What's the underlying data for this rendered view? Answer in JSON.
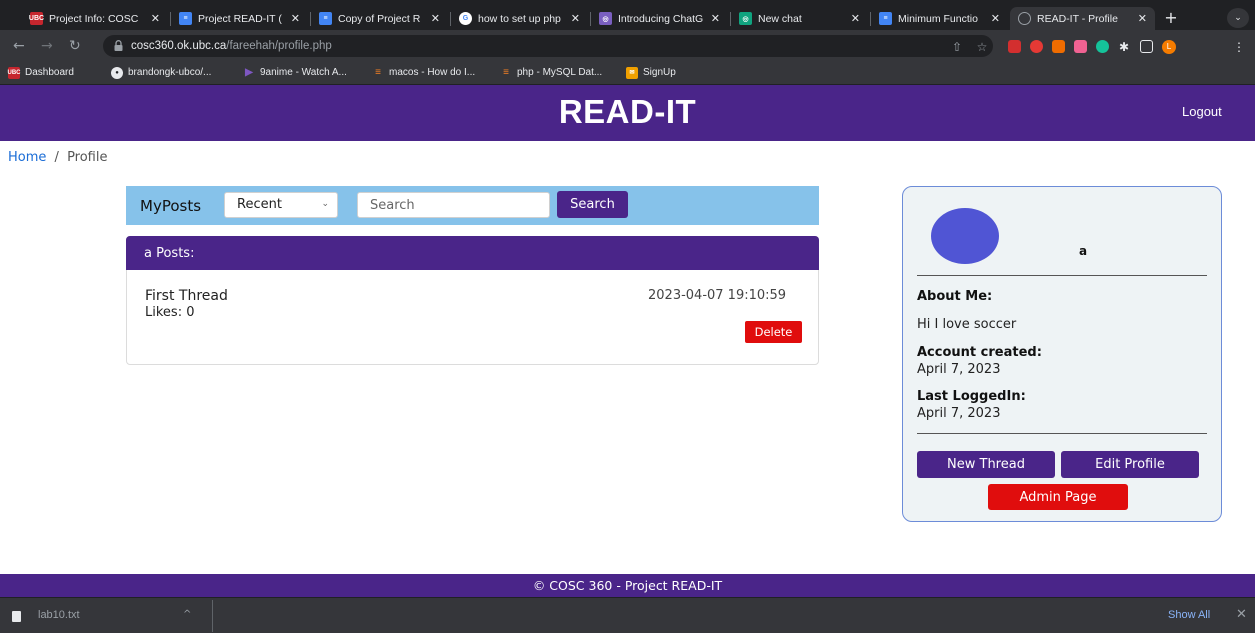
{
  "browser": {
    "tabs": [
      {
        "title": "Project Info: COSC",
        "favicon": "ubc-icon",
        "color": "#c6262e"
      },
      {
        "title": "Project READ-IT (",
        "favicon": "docs-icon",
        "color": "#4285f4"
      },
      {
        "title": "Copy of Project R",
        "favicon": "docs-icon",
        "color": "#4285f4"
      },
      {
        "title": "how to set up php",
        "favicon": "google-icon",
        "color": "#ffffff"
      },
      {
        "title": "Introducing ChatG",
        "favicon": "openai-icon",
        "color": "#7a5fc0"
      },
      {
        "title": "New chat",
        "favicon": "chatgpt-icon",
        "color": "#10a37f"
      },
      {
        "title": "Minimum Functio",
        "favicon": "docs-icon",
        "color": "#4285f4"
      },
      {
        "title": "READ-IT - Profile",
        "favicon": "globe-icon",
        "color": "#9aa0a6"
      }
    ],
    "url_host": "cosc360.ok.ubc.ca",
    "url_path": "/fareehah/profile.php",
    "bookmarks": [
      {
        "label": "Dashboard",
        "icon": "ubc-icon",
        "color": "#c6262e"
      },
      {
        "label": "brandongk-ubco/...",
        "icon": "github-icon",
        "color": "#e8eaed"
      },
      {
        "label": "9anime - Watch A...",
        "icon": "play-icon",
        "color": "#7e57c2"
      },
      {
        "label": "macos - How do I...",
        "icon": "stack-icon",
        "color": "#f48024"
      },
      {
        "label": "php - MySQL Dat...",
        "icon": "stack-icon",
        "color": "#f48024"
      },
      {
        "label": "SignUp",
        "icon": "app-icon",
        "color": "#f0a000"
      }
    ],
    "profile_initial": "L"
  },
  "site": {
    "title": "READ-IT",
    "logout": "Logout",
    "colors": {
      "primary": "#4a2589",
      "accent": "#86c2ea",
      "danger": "#e00d0d"
    }
  },
  "breadcrumb": {
    "home": "Home",
    "sep": "/",
    "current": "Profile"
  },
  "posts": {
    "heading": "MyPosts",
    "sort_value": "Recent",
    "search_placeholder": "Search",
    "search_button": "Search",
    "list_header": "a Posts:",
    "items": [
      {
        "title": "First Thread",
        "likes": "Likes: 0",
        "date": "2023-04-07 19:10:59",
        "delete": "Delete"
      }
    ]
  },
  "profile": {
    "username": "a",
    "about_label": "About Me:",
    "about_value": "Hi I love soccer",
    "created_label": "Account created:",
    "created_value": "April 7, 2023",
    "lastlogin_label": "Last LoggedIn:",
    "lastlogin_value": "April 7, 2023",
    "new_thread": "New Thread",
    "edit_profile": "Edit Profile",
    "admin_page": "Admin Page"
  },
  "footer": {
    "text": "© COSC 360 - Project READ-IT"
  },
  "downloads": {
    "file": "lab10.txt",
    "show_all": "Show All"
  }
}
